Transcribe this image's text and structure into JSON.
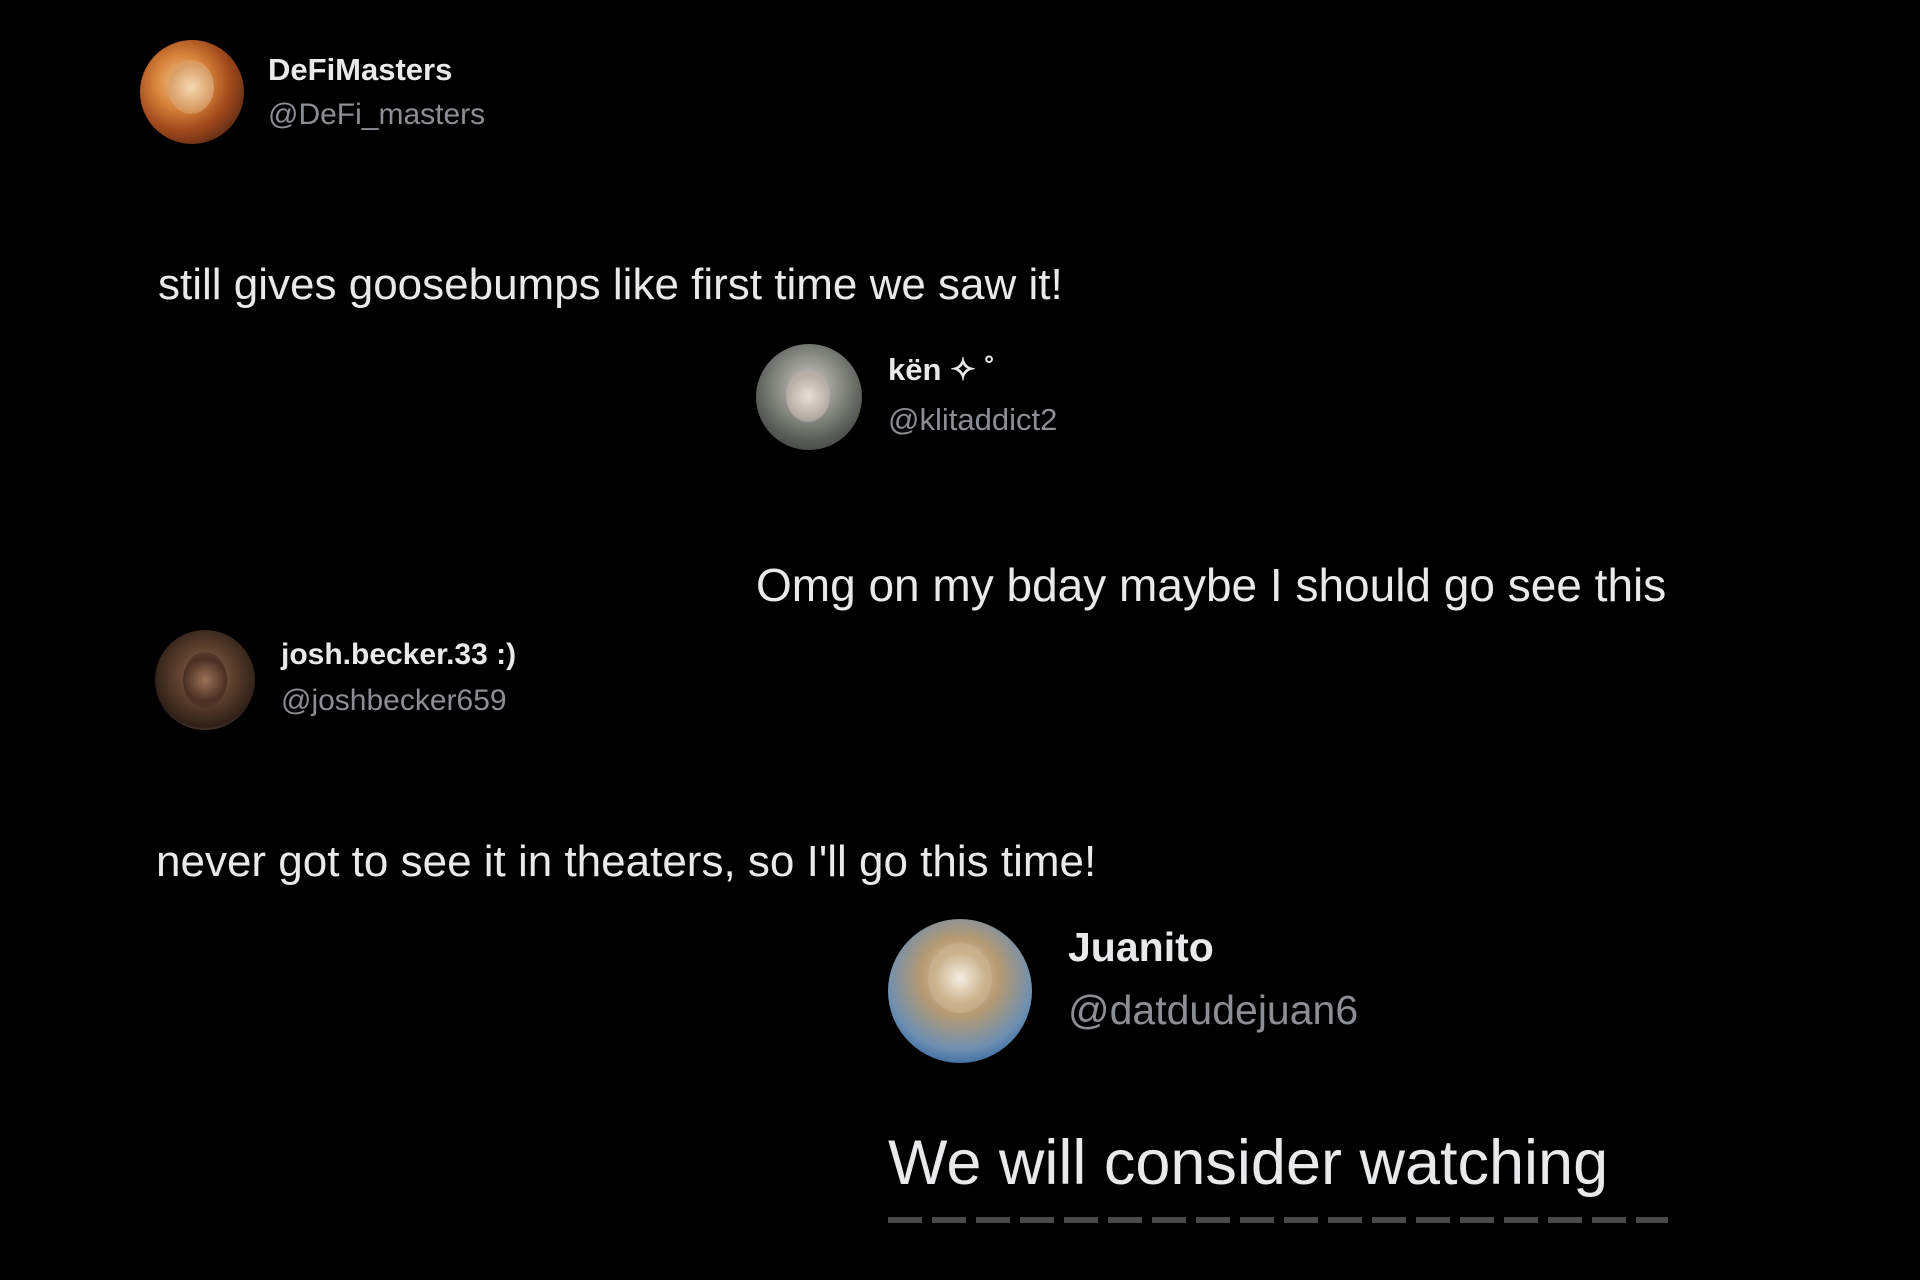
{
  "tweets": [
    {
      "display_name": "DeFiMasters",
      "handle": "@DeFi_masters",
      "text": "still gives goosebumps like first time we saw it!"
    },
    {
      "display_name": "kën ✧ ˚",
      "handle": "@klitaddict2",
      "text": "Omg on my bday maybe I should go see this"
    },
    {
      "display_name": "josh.becker.33 :)",
      "handle": "@joshbecker659",
      "text": "never got to see it in theaters, so I'll go this time!"
    },
    {
      "display_name": "Juanito",
      "handle": "@datdudejuan6",
      "text": "We will consider watching"
    }
  ],
  "colors": {
    "background": "#000000",
    "text_primary": "#e7e9ea",
    "text_secondary": "#8b8f93"
  }
}
